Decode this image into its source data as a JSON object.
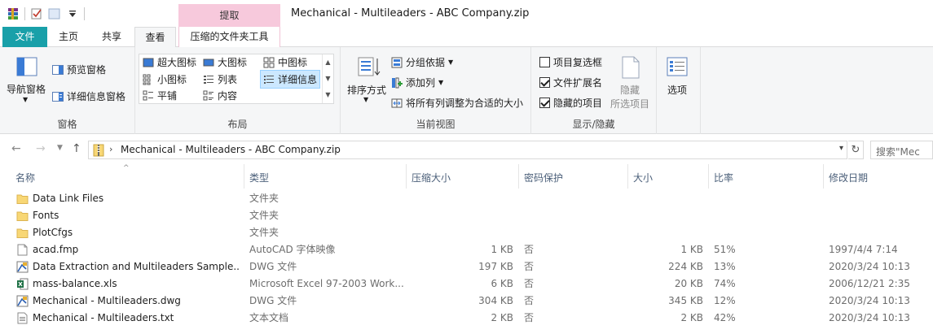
{
  "window": {
    "title": "Mechanical - Multileaders - ABC Company.zip",
    "context_header": "提取"
  },
  "tabs": [
    {
      "label": "文件"
    },
    {
      "label": "主页"
    },
    {
      "label": "共享"
    },
    {
      "label": "查看"
    },
    {
      "label": "压缩的文件夹工具"
    }
  ],
  "ribbon": {
    "panes": {
      "nav_pane": "导航窗格",
      "preview_pane": "预览窗格",
      "details_pane": "详细信息窗格",
      "label": "窗格"
    },
    "layout": {
      "items": [
        "超大图标",
        "大图标",
        "中图标",
        "小图标",
        "列表",
        "详细信息",
        "平铺",
        "内容"
      ],
      "selected": "详细信息",
      "label": "布局"
    },
    "current_view": {
      "sort_by": "排序方式",
      "group_by": "分组依据",
      "add_column": "添加列",
      "fit_columns": "将所有列调整为合适的大小",
      "label": "当前视图"
    },
    "show_hide": {
      "item_checkboxes": {
        "label": "项目复选框",
        "checked": false
      },
      "file_extensions": {
        "label": "文件扩展名",
        "checked": true
      },
      "hidden_items": {
        "label": "隐藏的项目",
        "checked": true
      },
      "hide_selected_1": "隐藏",
      "hide_selected_2": "所选项目",
      "label": "显示/隐藏"
    },
    "options": {
      "label": "选项"
    }
  },
  "address": {
    "path": "Mechanical - Multileaders - ABC Company.zip",
    "search_placeholder": "搜索\"Mec"
  },
  "columns": {
    "name": "名称",
    "type": "类型",
    "compressed_size": "压缩大小",
    "password": "密码保护",
    "size": "大小",
    "ratio": "比率",
    "modified": "修改日期"
  },
  "files": [
    {
      "icon": "folder-icon",
      "name": "Data Link Files",
      "type": "文件夹",
      "csize": "",
      "pwd": "",
      "size": "",
      "ratio": "",
      "date": ""
    },
    {
      "icon": "folder-icon",
      "name": "Fonts",
      "type": "文件夹",
      "csize": "",
      "pwd": "",
      "size": "",
      "ratio": "",
      "date": ""
    },
    {
      "icon": "folder-icon",
      "name": "PlotCfgs",
      "type": "文件夹",
      "csize": "",
      "pwd": "",
      "size": "",
      "ratio": "",
      "date": ""
    },
    {
      "icon": "generic-file-icon",
      "name": "acad.fmp",
      "type": "AutoCAD 字体映像",
      "csize": "1 KB",
      "pwd": "否",
      "size": "1 KB",
      "ratio": "51%",
      "date": "1997/4/4 7:14"
    },
    {
      "icon": "dwg-file-icon",
      "name": "Data Extraction and Multileaders Sample....",
      "type": "DWG 文件",
      "csize": "197 KB",
      "pwd": "否",
      "size": "224 KB",
      "ratio": "13%",
      "date": "2020/3/24 10:13"
    },
    {
      "icon": "excel-file-icon",
      "name": "mass-balance.xls",
      "type": "Microsoft Excel 97-2003 Work...",
      "csize": "6 KB",
      "pwd": "否",
      "size": "20 KB",
      "ratio": "74%",
      "date": "2006/12/21 2:35"
    },
    {
      "icon": "dwg-file-icon",
      "name": "Mechanical - Multileaders.dwg",
      "type": "DWG 文件",
      "csize": "304 KB",
      "pwd": "否",
      "size": "345 KB",
      "ratio": "12%",
      "date": "2020/3/24 10:13"
    },
    {
      "icon": "text-file-icon",
      "name": "Mechanical - Multileaders.txt",
      "type": "文本文档",
      "csize": "2 KB",
      "pwd": "否",
      "size": "2 KB",
      "ratio": "42%",
      "date": "2020/3/24 10:13"
    }
  ],
  "colors": {
    "file_tab": "#19a0a9",
    "context_tab": "#f7c9dc",
    "selection": "#cce8ff",
    "folder": "#f8d775"
  }
}
